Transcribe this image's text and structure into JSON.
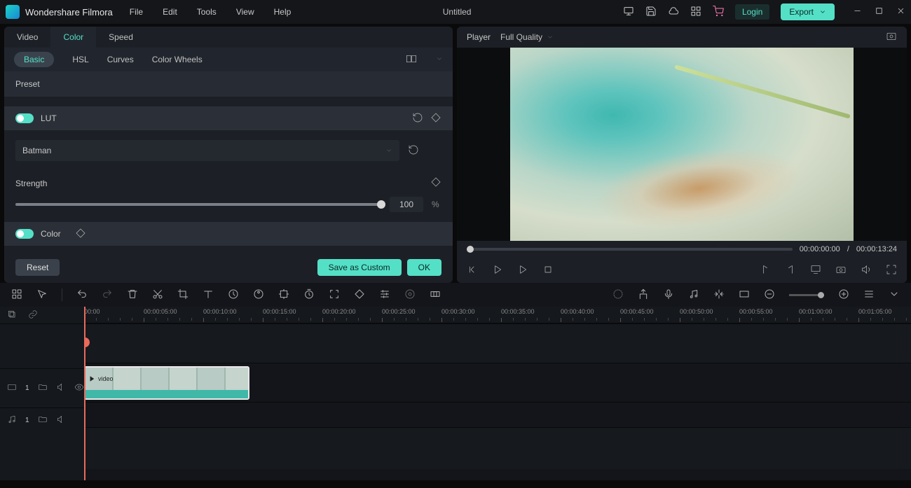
{
  "app": {
    "name": "Wondershare Filmora",
    "title": "Untitled"
  },
  "menu": {
    "file": "File",
    "edit": "Edit",
    "tools": "Tools",
    "view": "View",
    "help": "Help"
  },
  "header": {
    "login": "Login",
    "export": "Export"
  },
  "tabs": {
    "video": "Video",
    "color": "Color",
    "speed": "Speed"
  },
  "subtabs": {
    "basic": "Basic",
    "hsl": "HSL",
    "curves": "Curves",
    "colorwheels": "Color Wheels"
  },
  "preset": {
    "label": "Preset"
  },
  "lut": {
    "label": "LUT",
    "selected": "Batman",
    "strength_label": "Strength",
    "strength_value": "100",
    "strength_unit": "%"
  },
  "color_section": {
    "label": "Color"
  },
  "buttons": {
    "reset": "Reset",
    "save_custom": "Save as Custom",
    "ok": "OK"
  },
  "player": {
    "label": "Player",
    "quality": "Full Quality",
    "time_current": "00:00:00:00",
    "time_sep": "/",
    "time_total": "00:00:13:24"
  },
  "ruler": [
    "00:00",
    "00:00:05:00",
    "00:00:10:00",
    "00:00:15:00",
    "00:00:20:00",
    "00:00:25:00",
    "00:00:30:00",
    "00:00:35:00",
    "00:00:40:00",
    "00:00:45:00",
    "00:00:50:00",
    "00:00:55:00",
    "00:01:00:00",
    "00:01:05:00"
  ],
  "clip": {
    "name": "video"
  },
  "track": {
    "v1": "1",
    "a1": "1"
  }
}
